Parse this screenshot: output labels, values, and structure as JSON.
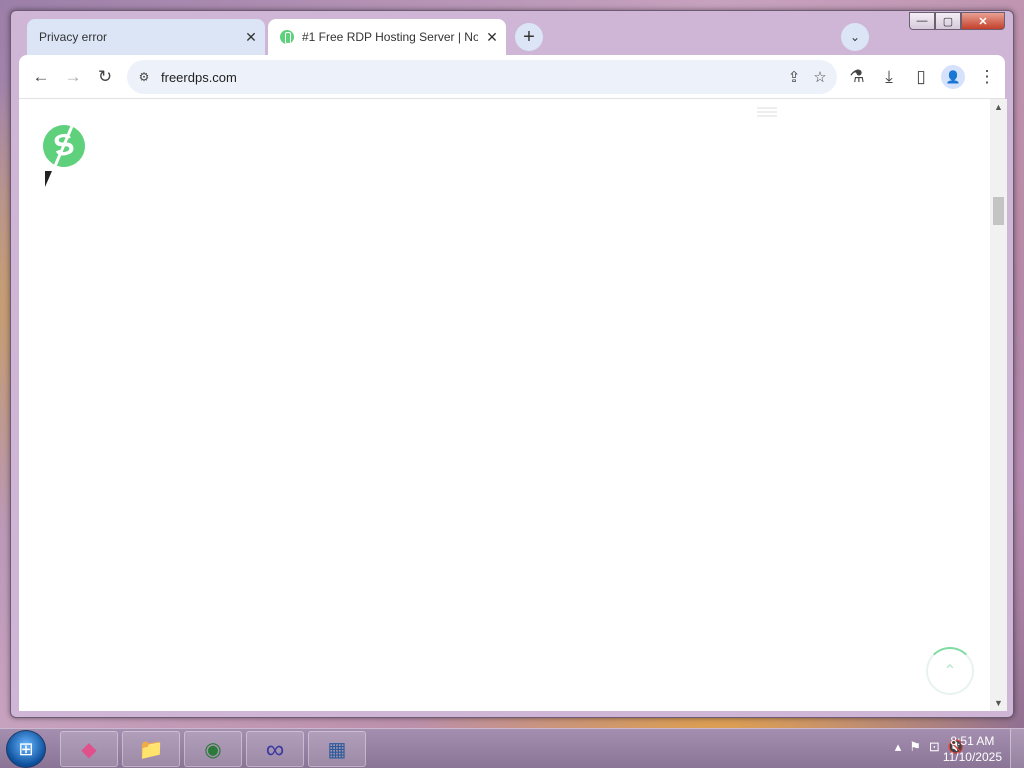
{
  "browser": {
    "tabs": [
      {
        "title": "Privacy error",
        "active": false,
        "close_glyph": "✕"
      },
      {
        "title": "#1 Free RDP Hosting Server | No",
        "active": true,
        "close_glyph": "✕",
        "favicon": "freerdps-logo-icon"
      }
    ],
    "new_tab_glyph": "+",
    "tab_search_glyph": "⌄",
    "window_controls": {
      "minimize": "—",
      "maximize": "▢",
      "close": "✕"
    },
    "toolbar": {
      "back_glyph": "←",
      "forward_glyph": "→",
      "reload_glyph": "↻",
      "url": "freerdps.com",
      "site_settings_glyph": "⚙",
      "share_glyph": "⇪",
      "bookmark_glyph": "☆",
      "labs_glyph": "⚗",
      "download_glyph": "⤓",
      "sidepanel_glyph": "▯",
      "profile_glyph": "👤",
      "menu_glyph": "⋮"
    }
  },
  "page": {
    "logo_letter": "S",
    "back_to_top_glyph": "⌃"
  },
  "scrollbar": {
    "up_glyph": "▲",
    "down_glyph": "▼"
  },
  "taskbar": {
    "start_glyph": "⊞",
    "pinned": [
      {
        "name": "app-diamond-icon",
        "glyph": "◆"
      },
      {
        "name": "file-explorer-icon",
        "glyph": "📁"
      },
      {
        "name": "chrome-icon",
        "glyph": "◉"
      },
      {
        "name": "infinity-app-icon",
        "glyph": "∞"
      },
      {
        "name": "image-viewer-icon",
        "glyph": "▦"
      }
    ],
    "tray": {
      "arrow": "▴",
      "flag": "⚑",
      "network": "⊡",
      "volume": "🔇"
    },
    "clock": {
      "time": "8:51 AM",
      "date": "11/10/2025"
    }
  },
  "colors": {
    "brand_green": "#5fd17c",
    "tab_bar": "#dbe5f6",
    "omnibox": "#edf2fa"
  }
}
